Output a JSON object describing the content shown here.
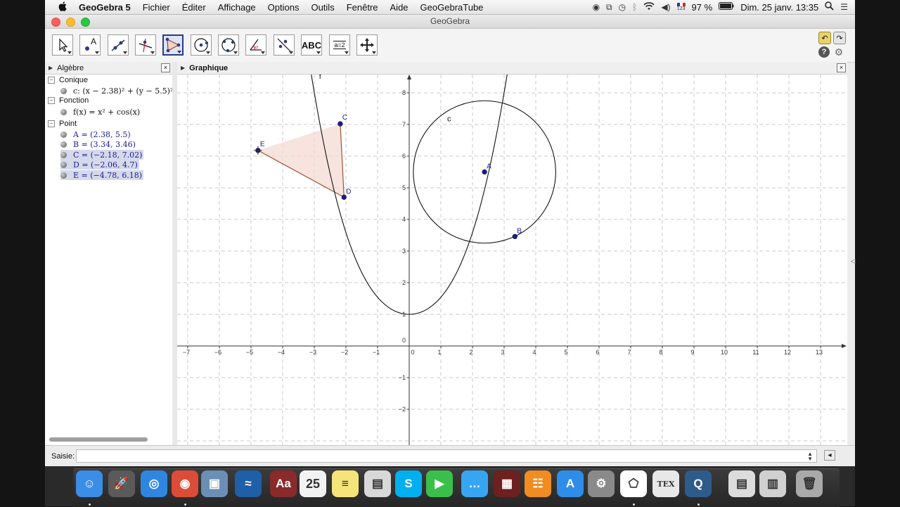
{
  "menubar": {
    "apple": "",
    "app": "GeoGebra 5",
    "items": [
      "Fichier",
      "Éditer",
      "Affichage",
      "Options",
      "Outils",
      "Fenêtre",
      "Aide",
      "GeoGebraTube"
    ],
    "battery": "97 %",
    "datetime": "Dim. 25 janv.  13:35",
    "keyboard_badge": "123"
  },
  "window": {
    "title": "GeoGebra",
    "traffic_colors": [
      "#fc5f57",
      "#fdbc2e",
      "#28c840"
    ]
  },
  "toolbar": {
    "tools": [
      {
        "name": "move-tool",
        "label": ""
      },
      {
        "name": "point-tool",
        "label": "A"
      },
      {
        "name": "line-tool",
        "label": ""
      },
      {
        "name": "perpendicular-tool",
        "label": ""
      },
      {
        "name": "polygon-tool",
        "label": "",
        "selected": true
      },
      {
        "name": "circle-tool",
        "label": ""
      },
      {
        "name": "conic-tool",
        "label": ""
      },
      {
        "name": "angle-tool",
        "label": ""
      },
      {
        "name": "reflect-tool",
        "label": ""
      },
      {
        "name": "text-tool",
        "label": "ABC"
      },
      {
        "name": "slider-tool",
        "label": "a=2"
      },
      {
        "name": "move-view-tool",
        "label": ""
      }
    ]
  },
  "algebra": {
    "title": "Algèbre",
    "categories": [
      {
        "label": "Conique",
        "items": [
          {
            "text": "c: (x − 2.38)² + (y − 5.5)²",
            "selected": false
          }
        ]
      },
      {
        "label": "Fonction",
        "items": [
          {
            "text": "f(x) = x² + cos(x)",
            "selected": false
          }
        ]
      },
      {
        "label": "Point",
        "items": [
          {
            "text": "A = (2.38, 5.5)",
            "selected": false
          },
          {
            "text": "B = (3.34, 3.46)",
            "selected": false
          },
          {
            "text": "C = (−2.18, 7.02)",
            "selected": true
          },
          {
            "text": "D = (−2.06, 4.7)",
            "selected": true
          },
          {
            "text": "E = (−4.78, 6.18)",
            "selected": true
          }
        ]
      }
    ]
  },
  "graphics": {
    "title": "Graphique",
    "x_ticks": [
      -7,
      -6,
      -5,
      -4,
      -3,
      -2,
      -1,
      0,
      1,
      2,
      3,
      4,
      5,
      6,
      7,
      8,
      9,
      10,
      11,
      12,
      13
    ],
    "y_ticks": [
      -2,
      -1,
      1,
      2,
      3,
      4,
      5,
      6,
      7,
      8
    ],
    "labels": {
      "f": "f",
      "c": "c"
    },
    "points": [
      {
        "name": "A",
        "x": 2.38,
        "y": 5.5
      },
      {
        "name": "B",
        "x": 3.34,
        "y": 3.46
      },
      {
        "name": "C",
        "x": -2.18,
        "y": 7.02
      },
      {
        "name": "D",
        "x": -2.06,
        "y": 4.7
      },
      {
        "name": "E",
        "x": -4.78,
        "y": 6.18
      }
    ],
    "circle": {
      "h": 2.38,
      "k": 5.5,
      "r": 2.25
    },
    "colors": {
      "point": "#1a1a9c",
      "polygon_fill": "#f3d9d2",
      "polygon_edge": "#a0522d",
      "axis": "#333333",
      "grid": "#c8c8c8"
    }
  },
  "input": {
    "label": "Saisie:",
    "placeholder": ""
  },
  "dock": {
    "apps": [
      {
        "name": "finder",
        "glyph": "☺",
        "color": "#3a8ee6"
      },
      {
        "name": "launchpad",
        "glyph": "🚀",
        "color": "#5a5a5a"
      },
      {
        "name": "safari",
        "glyph": "◎",
        "color": "#2f86e0"
      },
      {
        "name": "chrome",
        "glyph": "◉",
        "color": "#dd4b39"
      },
      {
        "name": "preview",
        "glyph": "▣",
        "color": "#6b8fb5"
      },
      {
        "name": "writer",
        "glyph": "≈",
        "color": "#1f5fa8"
      },
      {
        "name": "dictionary",
        "glyph": "Aa",
        "color": "#8a2a2a"
      },
      {
        "name": "calendar",
        "glyph": "25",
        "color": "#f2f2f2"
      },
      {
        "name": "notes",
        "glyph": "≡",
        "color": "#f5e47a"
      },
      {
        "name": "preview2",
        "glyph": "▤",
        "color": "#d8d8d8"
      },
      {
        "name": "skype",
        "glyph": "S",
        "color": "#00aff0"
      },
      {
        "name": "facetime",
        "glyph": "▶",
        "color": "#3bbf4b"
      },
      {
        "name": "messages",
        "glyph": "…",
        "color": "#37a6f2"
      },
      {
        "name": "photo-booth",
        "glyph": "▦",
        "color": "#6e1f1f"
      },
      {
        "name": "ibooks",
        "glyph": "☷",
        "color": "#f08c21"
      },
      {
        "name": "app-store",
        "glyph": "A",
        "color": "#2e8de8"
      },
      {
        "name": "system-preferences",
        "glyph": "⚙",
        "color": "#8a8a8a"
      },
      {
        "name": "geogebra",
        "glyph": "⬠",
        "color": "#ffffff"
      },
      {
        "name": "tex",
        "glyph": "TEX",
        "color": "#e8e8e8"
      },
      {
        "name": "quicktime",
        "glyph": "Q",
        "color": "#2d5c8a"
      },
      {
        "name": "documents",
        "glyph": "▤",
        "color": "#dcdcdc"
      },
      {
        "name": "downloads",
        "glyph": "▥",
        "color": "#d0d0d0"
      },
      {
        "name": "trash",
        "glyph": "🗑",
        "color": "#a9a9a9"
      }
    ]
  }
}
